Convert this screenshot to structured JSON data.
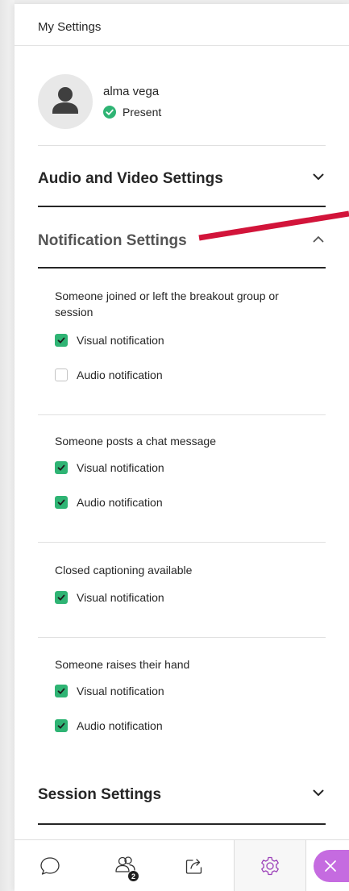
{
  "panel": {
    "title": "My Settings"
  },
  "user": {
    "name": "alma vega",
    "status": "Present"
  },
  "sections": {
    "audio_video": {
      "title": "Audio and Video Settings",
      "expanded": false
    },
    "notifications": {
      "title": "Notification Settings",
      "expanded": true
    },
    "session": {
      "title": "Session Settings",
      "expanded": false
    }
  },
  "notification_groups": [
    {
      "label": "Someone joined or left the breakout group or session",
      "options": [
        {
          "label": "Visual notification",
          "checked": true
        },
        {
          "label": "Audio notification",
          "checked": false
        }
      ]
    },
    {
      "label": "Someone posts a chat message",
      "options": [
        {
          "label": "Visual notification",
          "checked": true
        },
        {
          "label": "Audio notification",
          "checked": true
        }
      ]
    },
    {
      "label": "Closed captioning available",
      "options": [
        {
          "label": "Visual notification",
          "checked": true
        }
      ]
    },
    {
      "label": "Someone raises their hand",
      "options": [
        {
          "label": "Visual notification",
          "checked": true
        },
        {
          "label": "Audio notification",
          "checked": true
        }
      ]
    }
  ],
  "bottom_bar": {
    "tabs": [
      {
        "icon": "chat-icon",
        "active": false
      },
      {
        "icon": "attendees-icon",
        "active": false,
        "badge": "2"
      },
      {
        "icon": "share-content-icon",
        "active": false
      },
      {
        "icon": "gear-icon",
        "active": true
      }
    ],
    "close_icon": "close-icon"
  },
  "colors": {
    "accent_green": "#2fb474",
    "accent_purple": "#c56be0",
    "annotation_red": "#d2143a",
    "text": "#262626"
  }
}
